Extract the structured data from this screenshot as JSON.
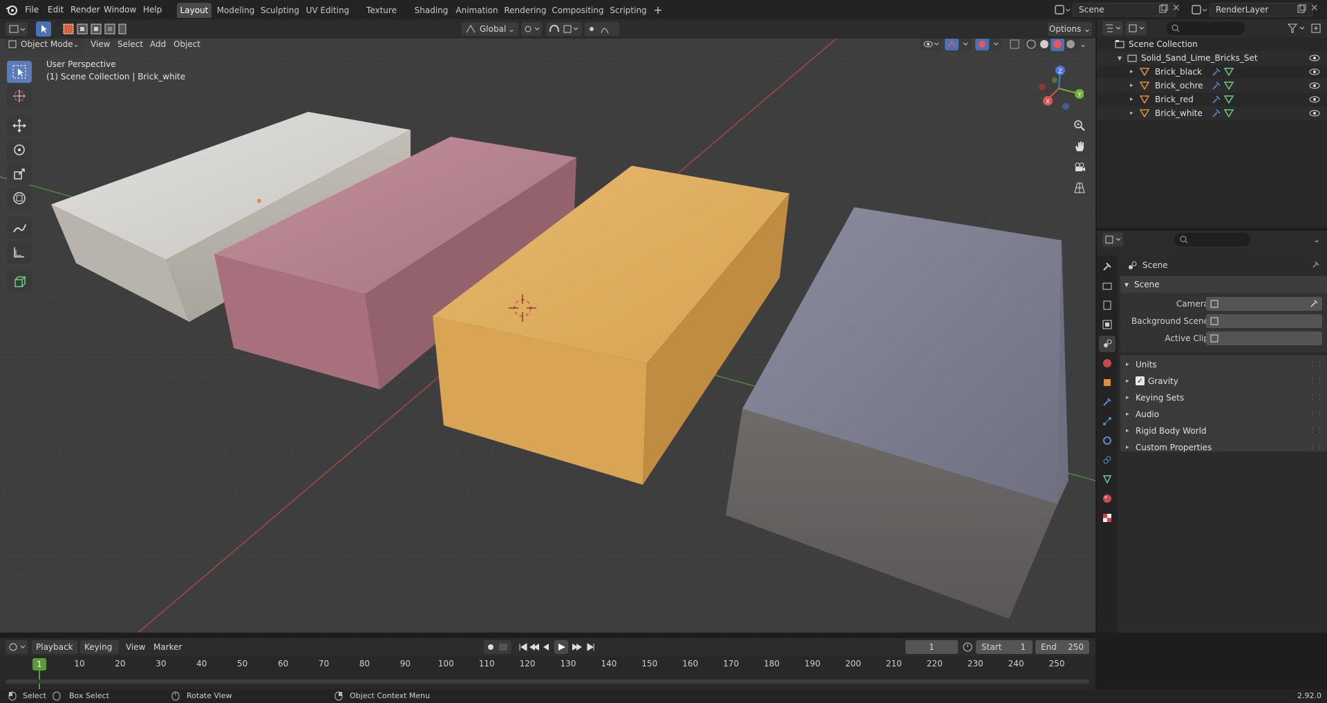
{
  "top_menu": [
    "File",
    "Edit",
    "Render",
    "Window",
    "Help"
  ],
  "workspace_tabs": [
    "Layout",
    "Modeling",
    "Sculpting",
    "UV Editing",
    "Texture Paint",
    "Shading",
    "Animation",
    "Rendering",
    "Compositing",
    "Scripting"
  ],
  "active_workspace": "Layout",
  "scene_field": "Scene",
  "view_layer_field": "RenderLayer",
  "viewport_header": {
    "mode": "Object Mode",
    "menus": [
      "View",
      "Select",
      "Add",
      "Object"
    ],
    "transform_orientation": "Global",
    "options_label": "Options"
  },
  "viewport": {
    "perspective_label": "User Perspective",
    "collection_label": "(1) Scene Collection | Brick_white"
  },
  "outliner": {
    "root": "Scene Collection",
    "collection": "Solid_Sand_Lime_Bricks_Set",
    "objects": [
      "Brick_black",
      "Brick_ochre",
      "Brick_red",
      "Brick_white"
    ]
  },
  "properties": {
    "breadcrumb": "Scene",
    "panel_title": "Scene",
    "fields": [
      {
        "label": "Camera"
      },
      {
        "label": "Background Scene"
      },
      {
        "label": "Active Clip"
      }
    ],
    "subpanels": [
      "Units",
      "Gravity",
      "Keying Sets",
      "Audio",
      "Rigid Body World",
      "Custom Properties"
    ],
    "gravity_checked": true
  },
  "timeline": {
    "menus": [
      "Playback",
      "Keying",
      "View",
      "Marker"
    ],
    "current_frame": "1",
    "start_label": "Start",
    "start_value": "1",
    "end_label": "End",
    "end_value": "250",
    "ruler": [
      "1",
      "10",
      "20",
      "30",
      "40",
      "50",
      "60",
      "70",
      "80",
      "90",
      "100",
      "110",
      "120",
      "130",
      "140",
      "150",
      "160",
      "170",
      "180",
      "190",
      "200",
      "210",
      "220",
      "230",
      "240",
      "250"
    ]
  },
  "statusbar": {
    "select": "Select",
    "box_select": "Box Select",
    "rotate_view": "Rotate View",
    "context_menu": "Object Context Menu",
    "version": "2.92.0"
  },
  "colors": {
    "accent": "#4772b3",
    "active_tool": "#5a7cb8",
    "grid_bg": "#3d3d3d",
    "axis_x": "#b84a4a",
    "axis_y": "#5a9a3a",
    "brick_white": "#c9c6c2",
    "brick_red": "#b07a85",
    "brick_ochre": "#d9a85a",
    "brick_black": "#7c7d8c",
    "object_orange": "#e08d3c"
  }
}
